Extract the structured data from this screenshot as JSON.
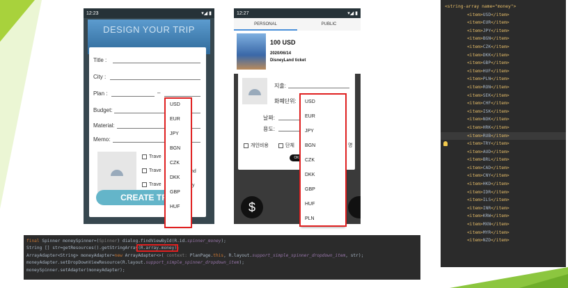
{
  "phone1": {
    "status_time": "12:23",
    "status_icons": "▾◢ ▮",
    "banner_text": "DESIGN YOUR TRIP",
    "labels": {
      "title": "Title :",
      "city": "City :",
      "plan": "Plan :",
      "plan_dash": "–",
      "budget": "Budget:",
      "material": "Material:",
      "memo": "Memo:"
    },
    "checkboxes": [
      "Trave",
      "Trave",
      "Trave"
    ],
    "checkbox_tails": [
      "",
      "nd",
      "y"
    ],
    "create_button": "CREATE TR",
    "dropdown": [
      "USD",
      "EUR",
      "JPY",
      "BGN",
      "CZK",
      "DKK",
      "GBP",
      "HUF"
    ]
  },
  "phone2": {
    "status_time": "12:27",
    "status_icons": "▾◢ ▮",
    "tabs": [
      "PERSONAL",
      "PUBLIC"
    ],
    "card": {
      "amount": "100 USD",
      "date": "2020/06/14",
      "name": "DisneyLand ticket"
    },
    "dialog": {
      "expense": "지출:",
      "currency": "화폐단위:",
      "date": "날짜:",
      "purpose": "용도:",
      "check_personal": "개인비용",
      "check_group": "단체",
      "tail": "명"
    },
    "ok_button": "OK",
    "fab_symbol": "$",
    "dropdown": [
      "USD",
      "EUR",
      "JPY",
      "BGN",
      "CZK",
      "DKK",
      "GBP",
      "HUF",
      "PLN"
    ]
  },
  "code": {
    "line1": {
      "kw": "final ",
      "a": "Spinner moneySpinner=(",
      "b": "Spinner",
      "c": ") dialog.findViewById(R.id.",
      "d": "spinner_money",
      "e": ");"
    },
    "line2": {
      "a": "String [] str=getResources().getStringArray",
      "b": "(R.array.money)",
      "c": ";"
    },
    "line3": {
      "a": "ArrayAdapter<String> moneyAdapter=",
      "kw": "new ",
      "b": "ArrayAdapter<>( ",
      "c": "context: ",
      "d": "PlanPage.",
      "e": "this",
      "f": ", R.layout.",
      "g": "support_simple_spinner_dropdown_item",
      "h": ", str);"
    },
    "line4": {
      "a": "moneyAdapter.setDropDownViewResource(R.layout.",
      "b": "support_simple_spinner_dropdown_item",
      "c": ");"
    },
    "line5": "moneySpinner.setAdapter(moneyAdapter);"
  },
  "xml": {
    "header": "<string-array name=\"money\">",
    "open": "<item>",
    "close": "</item>",
    "items": [
      "USD",
      "EUR",
      "JPY",
      "BGN",
      "CZK",
      "DKK",
      "GBP",
      "HUF",
      "PLN",
      "RON",
      "SEK",
      "CHF",
      "ISK",
      "NOK",
      "HRK",
      "RUB",
      "TRY",
      "AUD",
      "BRL",
      "CAD",
      "CNY",
      "HKD",
      "IDR",
      "ILS",
      "INR",
      "KRW",
      "MXN",
      "MYR",
      "NZD"
    ]
  }
}
